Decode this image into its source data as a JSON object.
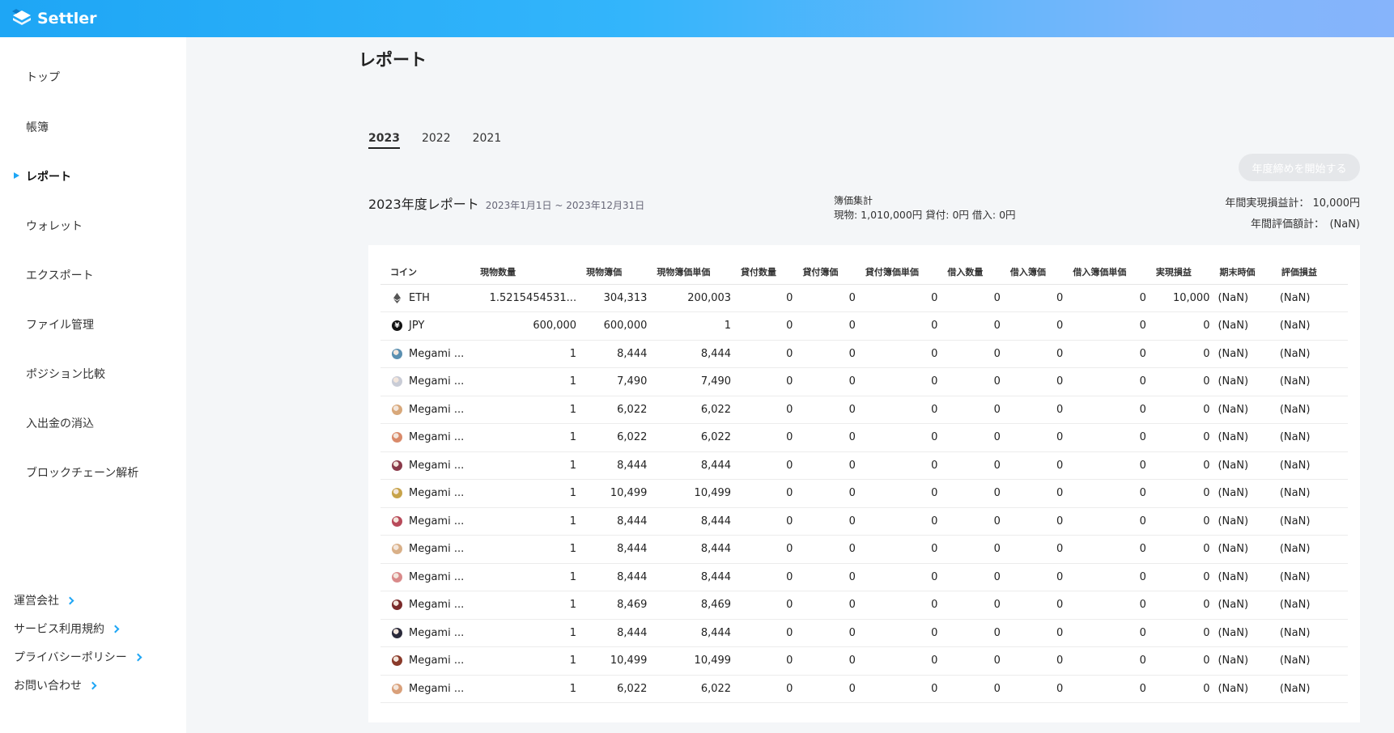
{
  "app": {
    "logo_text": "Settler"
  },
  "sidebar": {
    "items": [
      {
        "label": "トップ",
        "active": false
      },
      {
        "label": "帳簿",
        "active": false
      },
      {
        "label": "レポート",
        "active": true
      },
      {
        "label": "ウォレット",
        "active": false
      },
      {
        "label": "エクスポート",
        "active": false
      },
      {
        "label": "ファイル管理",
        "active": false
      },
      {
        "label": "ポジション比較",
        "active": false
      },
      {
        "label": "入出金の消込",
        "active": false
      },
      {
        "label": "ブロックチェーン解析",
        "active": false
      }
    ],
    "footer_links": [
      "運営会社",
      "サービス利用規約",
      "プライバシーポリシー",
      "お問い合わせ"
    ]
  },
  "page": {
    "title": "レポート",
    "year_tabs": [
      "2023",
      "2022",
      "2021"
    ],
    "active_year": "2023",
    "close_button_label": "年度締めを開始する",
    "report_title": "2023年度レポート",
    "report_range": "2023年1月1日 ~ 2023年12月31日",
    "book_label": "簿価集計",
    "book_values": "現物: 1,010,000円  貸付: 0円  借入: 0円",
    "realized_total": "年間実現損益計： 10,000円",
    "valuation_total": "年間評価額計：　(NaN)"
  },
  "table": {
    "headers": [
      "コイン",
      "現物数量",
      "現物簿価",
      "現物簿価単価",
      "貸付数量",
      "貸付簿価",
      "貸付簿価単価",
      "借入数量",
      "借入簿価",
      "借入簿価単価",
      "実現損益",
      "期末時価",
      "評価損益"
    ],
    "rows": [
      {
        "icon": "eth-icon",
        "color": "#555555",
        "coin": "ETH",
        "cells": [
          "1.5215454531...",
          "304,313",
          "200,003",
          "0",
          "0",
          "0",
          "0",
          "0",
          "0",
          "10,000",
          "(NaN)",
          "(NaN)"
        ]
      },
      {
        "icon": "jpy-icon",
        "color": "#111111",
        "coin": "JPY",
        "cells": [
          "600,000",
          "600,000",
          "1",
          "0",
          "0",
          "0",
          "0",
          "0",
          "0",
          "0",
          "(NaN)",
          "(NaN)"
        ]
      },
      {
        "icon": "nft-avatar-icon",
        "color": "#5a8fb0",
        "coin": "Megami ...",
        "cells": [
          "1",
          "8,444",
          "8,444",
          "0",
          "0",
          "0",
          "0",
          "0",
          "0",
          "0",
          "(NaN)",
          "(NaN)"
        ]
      },
      {
        "icon": "nft-avatar-icon",
        "color": "#c9ccd6",
        "coin": "Megami ...",
        "cells": [
          "1",
          "7,490",
          "7,490",
          "0",
          "0",
          "0",
          "0",
          "0",
          "0",
          "0",
          "(NaN)",
          "(NaN)"
        ]
      },
      {
        "icon": "nft-avatar-icon",
        "color": "#d8a87a",
        "coin": "Megami ...",
        "cells": [
          "1",
          "6,022",
          "6,022",
          "0",
          "0",
          "0",
          "0",
          "0",
          "0",
          "0",
          "(NaN)",
          "(NaN)"
        ]
      },
      {
        "icon": "nft-avatar-icon",
        "color": "#d98a6a",
        "coin": "Megami ...",
        "cells": [
          "1",
          "6,022",
          "6,022",
          "0",
          "0",
          "0",
          "0",
          "0",
          "0",
          "0",
          "(NaN)",
          "(NaN)"
        ]
      },
      {
        "icon": "nft-avatar-icon",
        "color": "#8a3a4a",
        "coin": "Megami ...",
        "cells": [
          "1",
          "8,444",
          "8,444",
          "0",
          "0",
          "0",
          "0",
          "0",
          "0",
          "0",
          "(NaN)",
          "(NaN)"
        ]
      },
      {
        "icon": "nft-avatar-icon",
        "color": "#c7a34a",
        "coin": "Megami ...",
        "cells": [
          "1",
          "10,499",
          "10,499",
          "0",
          "0",
          "0",
          "0",
          "0",
          "0",
          "0",
          "(NaN)",
          "(NaN)"
        ]
      },
      {
        "icon": "nft-avatar-icon",
        "color": "#b84a5a",
        "coin": "Megami ...",
        "cells": [
          "1",
          "8,444",
          "8,444",
          "0",
          "0",
          "0",
          "0",
          "0",
          "0",
          "0",
          "(NaN)",
          "(NaN)"
        ]
      },
      {
        "icon": "nft-avatar-icon",
        "color": "#d9b088",
        "coin": "Megami ...",
        "cells": [
          "1",
          "8,444",
          "8,444",
          "0",
          "0",
          "0",
          "0",
          "0",
          "0",
          "0",
          "(NaN)",
          "(NaN)"
        ]
      },
      {
        "icon": "nft-avatar-icon",
        "color": "#d98a8a",
        "coin": "Megami ...",
        "cells": [
          "1",
          "8,444",
          "8,444",
          "0",
          "0",
          "0",
          "0",
          "0",
          "0",
          "0",
          "(NaN)",
          "(NaN)"
        ]
      },
      {
        "icon": "nft-avatar-icon",
        "color": "#7a2a2a",
        "coin": "Megami ...",
        "cells": [
          "1",
          "8,469",
          "8,469",
          "0",
          "0",
          "0",
          "0",
          "0",
          "0",
          "0",
          "(NaN)",
          "(NaN)"
        ]
      },
      {
        "icon": "nft-avatar-icon",
        "color": "#2a2a3a",
        "coin": "Megami ...",
        "cells": [
          "1",
          "8,444",
          "8,444",
          "0",
          "0",
          "0",
          "0",
          "0",
          "0",
          "0",
          "(NaN)",
          "(NaN)"
        ]
      },
      {
        "icon": "nft-avatar-icon",
        "color": "#8a3a2a",
        "coin": "Megami ...",
        "cells": [
          "1",
          "10,499",
          "10,499",
          "0",
          "0",
          "0",
          "0",
          "0",
          "0",
          "0",
          "(NaN)",
          "(NaN)"
        ]
      },
      {
        "icon": "nft-avatar-icon",
        "color": "#d9a07a",
        "coin": "Megami ...",
        "cells": [
          "1",
          "6,022",
          "6,022",
          "0",
          "0",
          "0",
          "0",
          "0",
          "0",
          "0",
          "(NaN)",
          "(NaN)"
        ]
      }
    ]
  }
}
